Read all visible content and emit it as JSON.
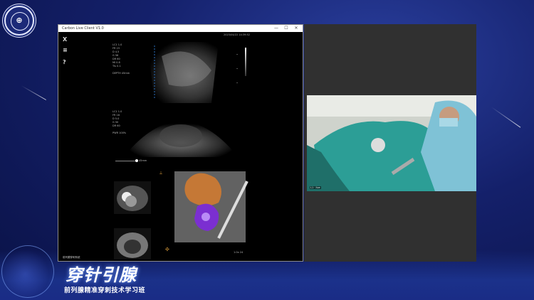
{
  "app": {
    "title": "Carbon Live Client V1.0",
    "timestamp": "2023/04/22 14:39:52",
    "window_buttons": [
      "—",
      "☐",
      "✕"
    ],
    "side_icons": [
      "X",
      "≡",
      "?"
    ]
  },
  "panes": {
    "sagittal": {
      "readout": "LC1 1.0\nFR 23\nD 4.5\nG 56\nDR 60\nMI 0.8\nTIs 0.1\n\nDEPTH 45mm"
    },
    "transverse": {
      "readout": "LC1 1.0\nFR 18\nD 5.0\nG 50\nDR 60\n\nPWR 100%"
    },
    "slider_value": "45mm",
    "footer_label": "前列腺穿刺系统",
    "zoom_label": "1.0x  24"
  },
  "video": {
    "caption": "L1 · live"
  },
  "banner": {
    "headline": "穿针引腺",
    "subtitle": "前列腺精准穿刺技术学习班",
    "accent": "#6f9cff"
  }
}
